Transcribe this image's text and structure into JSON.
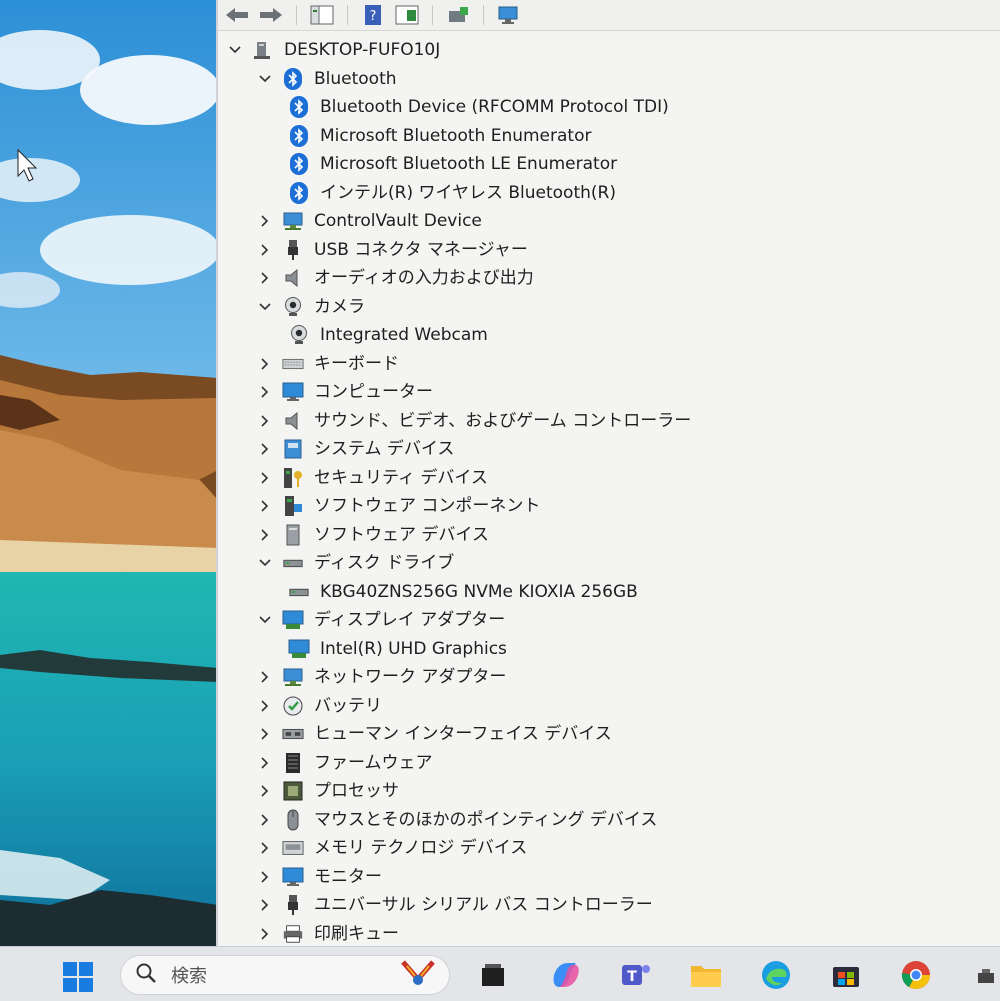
{
  "computer_name": "DESKTOP-FUFO10J",
  "tree": [
    {
      "label": "Bluetooth",
      "icon": "bluetooth-icon",
      "expanded": true,
      "children": [
        {
          "label": "Bluetooth Device (RFCOMM Protocol TDI)",
          "icon": "bluetooth-icon"
        },
        {
          "label": "Microsoft Bluetooth Enumerator",
          "icon": "bluetooth-icon"
        },
        {
          "label": "Microsoft Bluetooth LE Enumerator",
          "icon": "bluetooth-icon"
        },
        {
          "label": "インテル(R) ワイヤレス Bluetooth(R)",
          "icon": "bluetooth-icon"
        }
      ]
    },
    {
      "label": "ControlVault Device",
      "icon": "network-monitor-icon",
      "expanded": false
    },
    {
      "label": "USB コネクタ マネージャー",
      "icon": "usb-plug-icon",
      "expanded": false
    },
    {
      "label": "オーディオの入力および出力",
      "icon": "speaker-icon",
      "expanded": false
    },
    {
      "label": "カメラ",
      "icon": "webcam-icon",
      "expanded": true,
      "children": [
        {
          "label": "Integrated Webcam",
          "icon": "webcam-icon"
        }
      ]
    },
    {
      "label": "キーボード",
      "icon": "keyboard-icon",
      "expanded": false
    },
    {
      "label": "コンピューター",
      "icon": "monitor-icon",
      "expanded": false
    },
    {
      "label": "サウンド、ビデオ、およびゲーム コントローラー",
      "icon": "speaker-icon",
      "expanded": false
    },
    {
      "label": "システム デバイス",
      "icon": "system-device-icon",
      "expanded": false
    },
    {
      "label": "セキュリティ デバイス",
      "icon": "security-key-icon",
      "expanded": false
    },
    {
      "label": "ソフトウェア コンポーネント",
      "icon": "software-component-icon",
      "expanded": false
    },
    {
      "label": "ソフトウェア デバイス",
      "icon": "software-device-icon",
      "expanded": false
    },
    {
      "label": "ディスク ドライブ",
      "icon": "disk-drive-icon",
      "expanded": true,
      "children": [
        {
          "label": "KBG40ZNS256G NVMe KIOXIA 256GB",
          "icon": "disk-drive-icon"
        }
      ]
    },
    {
      "label": "ディスプレイ アダプター",
      "icon": "display-adapter-icon",
      "expanded": true,
      "children": [
        {
          "label": "Intel(R) UHD Graphics",
          "icon": "display-adapter-icon"
        }
      ]
    },
    {
      "label": "ネットワーク アダプター",
      "icon": "network-monitor-icon",
      "expanded": false
    },
    {
      "label": "バッテリ",
      "icon": "battery-icon",
      "expanded": false
    },
    {
      "label": "ヒューマン インターフェイス デバイス",
      "icon": "hid-icon",
      "expanded": false
    },
    {
      "label": "ファームウェア",
      "icon": "firmware-icon",
      "expanded": false
    },
    {
      "label": "プロセッサ",
      "icon": "processor-icon",
      "expanded": false
    },
    {
      "label": "マウスとそのほかのポインティング デバイス",
      "icon": "mouse-icon",
      "expanded": false
    },
    {
      "label": "メモリ テクノロジ デバイス",
      "icon": "memory-icon",
      "expanded": false
    },
    {
      "label": "モニター",
      "icon": "monitor-icon",
      "expanded": false
    },
    {
      "label": "ユニバーサル シリアル バス コントローラー",
      "icon": "usb-plug-icon",
      "expanded": false
    },
    {
      "label": "印刷キュー",
      "icon": "printer-icon",
      "expanded": false
    }
  ],
  "taskbar": {
    "search_placeholder": "検索",
    "apps": [
      "widgets-icon",
      "task-view-icon",
      "copilot-icon",
      "teams-icon",
      "file-explorer-icon",
      "edge-icon",
      "store-icon",
      "chrome-icon",
      "system-tray-icon"
    ]
  },
  "colors": {
    "bluetooth": "#1c6fd6",
    "tree_text": "#1e1e1e",
    "window_bg": "#f4f4f2",
    "taskbar_bg": "#e3e5e8"
  }
}
